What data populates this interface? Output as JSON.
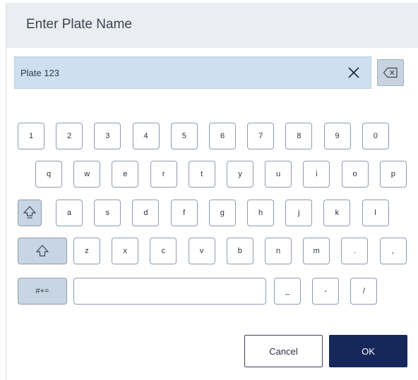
{
  "dialog": {
    "title": "Enter Plate Name",
    "input_value": "Plate 123",
    "cancel_label": "Cancel",
    "ok_label": "OK"
  },
  "keyboard": {
    "row1": [
      "1",
      "2",
      "3",
      "4",
      "5",
      "6",
      "7",
      "8",
      "9",
      "0"
    ],
    "row2": [
      "q",
      "w",
      "e",
      "r",
      "t",
      "y",
      "u",
      "i",
      "o",
      "p"
    ],
    "row3": [
      "a",
      "s",
      "d",
      "f",
      "g",
      "h",
      "j",
      "k",
      "l"
    ],
    "row4": [
      "z",
      "x",
      "c",
      "v",
      "b",
      "n",
      "m",
      ".",
      ","
    ],
    "row5": [
      "_",
      "-",
      "/"
    ],
    "symbols_label": "#+=",
    "caps_lock_icon": "caps-lock-icon",
    "shift_icon": "shift-icon",
    "backspace_icon": "backspace-icon",
    "clear_icon": "close-icon"
  },
  "colors": {
    "header_bg": "#eaeef3",
    "input_bg": "#cddff1",
    "modifier_key_bg": "#c8d5e2",
    "primary_button": "#16275a"
  }
}
